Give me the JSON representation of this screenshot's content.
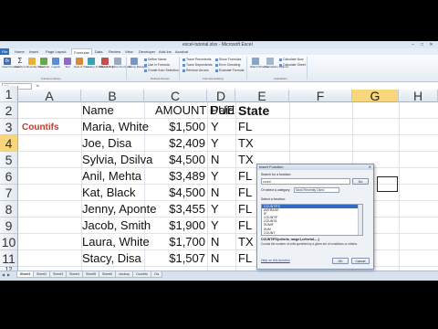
{
  "window": {
    "title": "excel-tutorial.xlsx - Microsoft Excel",
    "controls": [
      "–",
      "□",
      "✕"
    ]
  },
  "ribbon": {
    "tabs": [
      "File",
      "Home",
      "Insert",
      "Page Layout",
      "Formulas",
      "Data",
      "Review",
      "View",
      "Developer",
      "Add-Ins",
      "Acrobat"
    ],
    "active_tab": "Formulas",
    "buttons": [
      "Insert Function",
      "AutoSum",
      "Recently Used",
      "Financial",
      "Logical",
      "Text",
      "Date & Time",
      "Lookup & Reference",
      "Math & Trig",
      "More Functions",
      "Name Manager"
    ],
    "name_group_items": [
      "Define Name",
      "Use in Formula",
      "Create from Selection"
    ],
    "audit_group_items": [
      "Trace Precedents",
      "Trace Dependents",
      "Remove Arrows",
      "Show Formulas",
      "Error Checking",
      "Evaluate Formula"
    ],
    "calc_buttons": [
      "Watch Window",
      "Calculation Options"
    ],
    "calc_group_items": [
      "Calculate Now",
      "Calculate Sheet"
    ],
    "group_labels": [
      "Function Library",
      "Defined Names",
      "Formula Auditing",
      "Calculation"
    ]
  },
  "formula_bar": {
    "name_box": "G4",
    "fx": "fx"
  },
  "sheet": {
    "columns": [
      "A",
      "B",
      "C",
      "D",
      "E",
      "F",
      "G",
      "H"
    ],
    "selected_column": "G",
    "row_numbers": [
      "1",
      "2",
      "3",
      "4",
      "5",
      "6",
      "7",
      "8",
      "9",
      "10",
      "11",
      "12"
    ],
    "selected_row": "4",
    "headers": {
      "name": "Name",
      "amount_due": "AMOUNT DUE",
      "paid": "Paid",
      "state": "State"
    },
    "label_a3": "Countifs",
    "rows": [
      {
        "name": "Maria, White",
        "amount": "$1,500",
        "paid": "Y",
        "state": "FL"
      },
      {
        "name": "Joe, Disa",
        "amount": "$2,409",
        "paid": "Y",
        "state": "TX"
      },
      {
        "name": "Sylvia, Dsilva",
        "amount": "$4,500",
        "paid": "N",
        "state": "TX"
      },
      {
        "name": "Anil, Mehta",
        "amount": "$3,489",
        "paid": "Y",
        "state": "FL"
      },
      {
        "name": "Kat, Black",
        "amount": "$4,500",
        "paid": "N",
        "state": "FL"
      },
      {
        "name": "Jenny, Aponte",
        "amount": "$3,455",
        "paid": "Y",
        "state": "FL"
      },
      {
        "name": "Jacob, Smith",
        "amount": "$1,900",
        "paid": "Y",
        "state": "FL"
      },
      {
        "name": "Laura, White",
        "amount": "$1,700",
        "paid": "N",
        "state": "TX"
      },
      {
        "name": "Stacy, Disa",
        "amount": "$1,507",
        "paid": "N",
        "state": "FL"
      }
    ]
  },
  "sheet_tabs": [
    "Sheet1",
    "Sheet2",
    "Sheet3",
    "Sheet4",
    "Sheet5",
    "Sheet6",
    "vlookup",
    "Countifs",
    "Cts"
  ],
  "active_sheet": "Sheet1",
  "dialog": {
    "title": "Insert Function",
    "search_label": "Search for a function:",
    "search_value": "count",
    "go_button": "Go",
    "category_label": "Or select a category:",
    "category_value": "Most Recently Used",
    "select_label": "Select a function:",
    "functions": [
      "COUNTIFS",
      "AVERAGE",
      "IF",
      "COUNTIF",
      "COUNTA",
      "SUMIF",
      "SUM",
      "COUNT"
    ],
    "selected_function": "COUNTIFS",
    "syntax": "COUNTIFS(criteria_range1,criteria1,...)",
    "description": "Counts the number of cells specified by a given set of conditions or criteria.",
    "help_link": "Help on this function",
    "ok_button": "OK",
    "cancel_button": "Cancel",
    "close": "✕"
  }
}
